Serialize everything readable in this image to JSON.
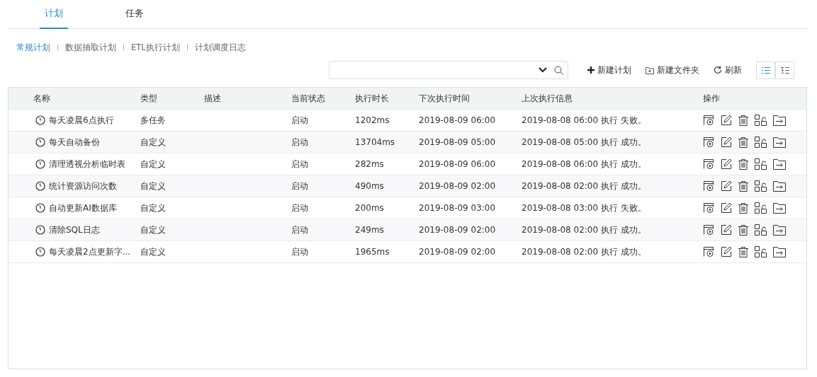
{
  "tabs": [
    {
      "label": "计划",
      "selected": true
    },
    {
      "label": "任务",
      "selected": false
    }
  ],
  "subtabs": [
    {
      "label": "常规计划",
      "selected": true
    },
    {
      "label": "数据抽取计划",
      "selected": false
    },
    {
      "label": "ETL执行计划",
      "selected": false
    },
    {
      "label": "计划调度日志",
      "selected": false
    }
  ],
  "toolbar": {
    "actions": [
      {
        "kind": "add",
        "label": "新建计划"
      },
      {
        "kind": "folder",
        "label": "新建文件夹"
      },
      {
        "kind": "refresh",
        "label": "刷新"
      }
    ],
    "views": [
      {
        "kind": "list",
        "selected": true
      },
      {
        "kind": "tree",
        "selected": false
      }
    ]
  },
  "table": {
    "columns": [
      "名称",
      "类型",
      "描述",
      "当前状态",
      "执行时长",
      "下次执行时间",
      "上次执行信息",
      "操作"
    ],
    "rows": [
      {
        "name": "每天凌晨6点执行",
        "type": "多任务",
        "status": "启动",
        "duration": "1202ms",
        "next": "2019-08-09 06:00",
        "last": "2019-08-08 06:00 执行 失败。"
      },
      {
        "name": "每天自动备份",
        "type": "自定义",
        "status": "启动",
        "duration": "13704ms",
        "next": "2019-08-09 05:00",
        "last": "2019-08-08 05:00 执行 成功。"
      },
      {
        "name": "清理透视分析临时表",
        "type": "自定义",
        "status": "启动",
        "duration": "282ms",
        "next": "2019-08-09 06:00",
        "last": "2019-08-08 06:00 执行 成功。"
      },
      {
        "name": "统计资源访问次数",
        "type": "自定义",
        "status": "启动",
        "duration": "490ms",
        "next": "2019-08-09 02:00",
        "last": "2019-08-08 02:00 执行 成功。"
      },
      {
        "name": "自动更新AI数据库",
        "type": "自定义",
        "status": "启动",
        "duration": "200ms",
        "next": "2019-08-09 03:00",
        "last": "2019-08-08 03:00 执行 失败。"
      },
      {
        "name": "清除SQL日志",
        "type": "自定义",
        "status": "启动",
        "duration": "249ms",
        "next": "2019-08-09 02:00",
        "last": "2019-08-08 02:00 执行 成功。"
      },
      {
        "name": "每天凌晨2点更新字...",
        "type": "自定义",
        "status": "启动",
        "duration": "1965ms",
        "next": "2019-08-09 02:00",
        "last": "2019-08-08 02:00 执行 成功。"
      }
    ]
  }
}
